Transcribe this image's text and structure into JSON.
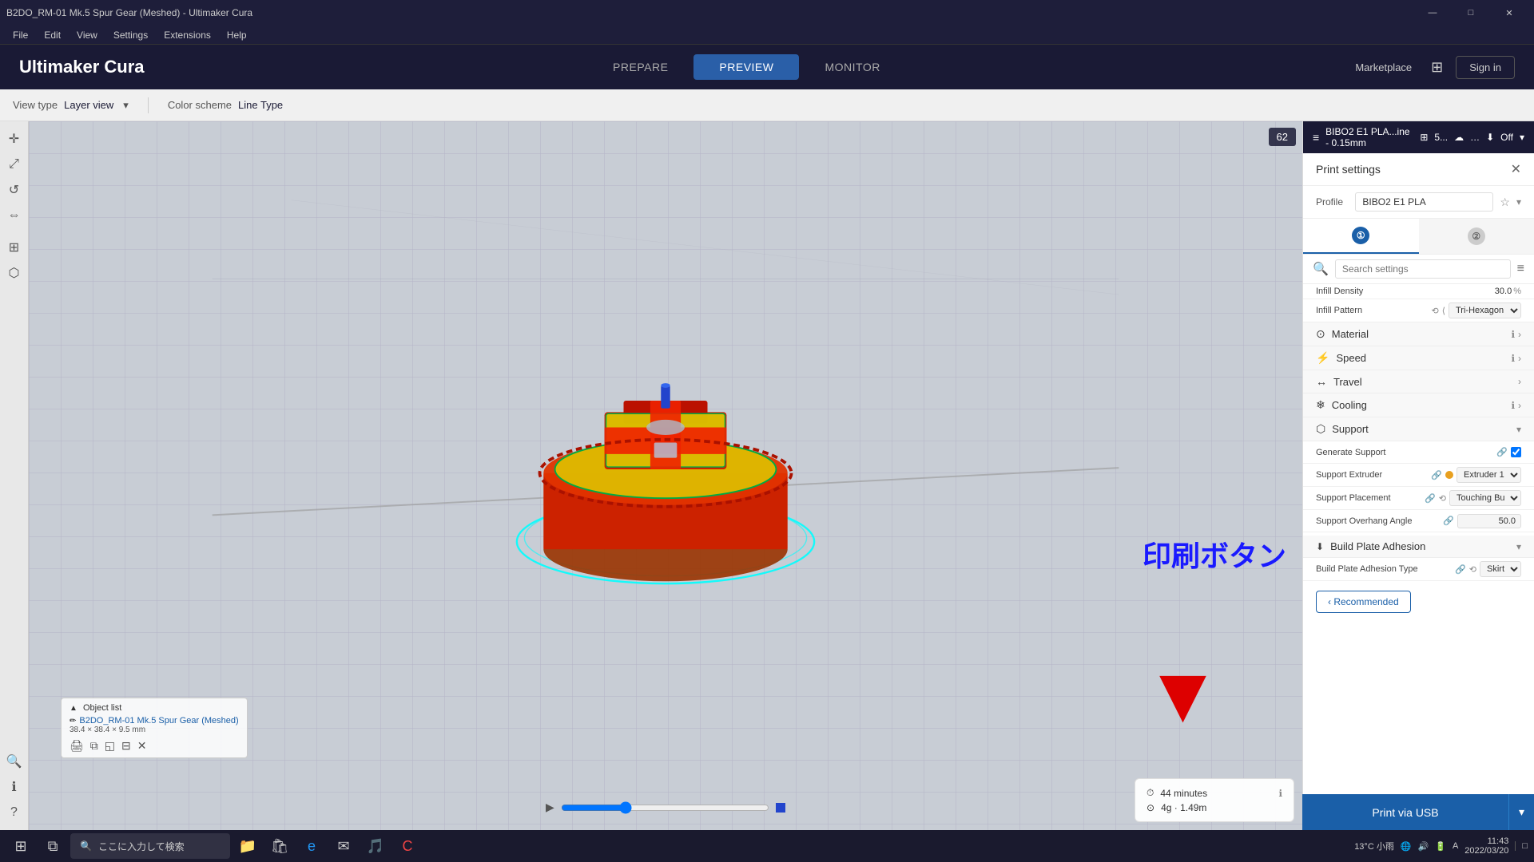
{
  "window": {
    "title": "B2DO_RM-01 Mk.5 Spur Gear (Meshed) - Ultimaker Cura",
    "min_btn": "—",
    "max_btn": "□",
    "close_btn": "✕"
  },
  "menubar": {
    "items": [
      "File",
      "Edit",
      "View",
      "Settings",
      "Extensions",
      "Help"
    ]
  },
  "toolbar": {
    "logo_text": "Ultimaker",
    "logo_cura": " Cura",
    "tabs": [
      "PREPARE",
      "PREVIEW",
      "MONITOR"
    ],
    "active_tab": "PREVIEW",
    "marketplace": "Marketplace",
    "signin": "Sign in"
  },
  "view_bar": {
    "view_type_label": "View type",
    "view_type_value": "Layer view",
    "color_scheme_label": "Color scheme",
    "color_scheme_value": "Line Type"
  },
  "printer_bar": {
    "printer_name": "BIBO2 E1 PLA...ine - 0.15mm"
  },
  "print_settings": {
    "title": "Print settings",
    "profile_label": "Profile",
    "profile_value": "BIBO2 E1 PLA",
    "extruder1_label": "①",
    "extruder2_label": "②",
    "search_placeholder": "Search settings",
    "sections": [
      {
        "id": "material",
        "icon": "⊙",
        "name": "Material",
        "expanded": true
      },
      {
        "id": "speed",
        "icon": "⚡",
        "name": "Speed",
        "expanded": false
      },
      {
        "id": "travel",
        "icon": "↔",
        "name": "Travel",
        "expanded": false
      },
      {
        "id": "cooling",
        "icon": "❄",
        "name": "Cooling",
        "expanded": false
      },
      {
        "id": "support",
        "icon": "⬡",
        "name": "Support",
        "expanded": true
      },
      {
        "id": "build_plate_adhesion",
        "icon": "⬜",
        "name": "Build Plate Adhesion",
        "expanded": true
      }
    ],
    "infill_density_label": "Infill Density",
    "infill_density_value": "30.0",
    "infill_pattern_label": "Infill Pattern",
    "infill_pattern_value": "Tri-Hexagon",
    "generate_support_label": "Generate Support",
    "generate_support_checked": true,
    "support_extruder_label": "Support Extruder",
    "support_extruder_value": "Extruder 1",
    "support_placement_label": "Support Placement",
    "support_placement_value": "Touching Buil...",
    "support_overhang_label": "Support Overhang Angle",
    "support_overhang_value": "50.0",
    "build_plate_adhesion_type_label": "Build Plate Adhesion Type",
    "build_plate_adhesion_type_value": "Skirt"
  },
  "recommended_btn": "‹ Recommended",
  "object_list": {
    "title": "Object list",
    "obj_name": "B2DO_RM-01 Mk.5 Spur Gear (Meshed)",
    "obj_size": "38.4 × 38.4 × 9.5 mm"
  },
  "print_time": {
    "time_label": "44 minutes",
    "material_label": "4g · 1.49m"
  },
  "print_button": {
    "label": "Print via USB",
    "dropdown": "▾"
  },
  "jp_annotation": "印刷ボタン",
  "layer_number": "62",
  "taskbar": {
    "start_icon": "⊞",
    "search_text": "ここに入力して検索",
    "time": "11:43",
    "date": "2022/03/20",
    "weather": "13°C 小雨"
  }
}
